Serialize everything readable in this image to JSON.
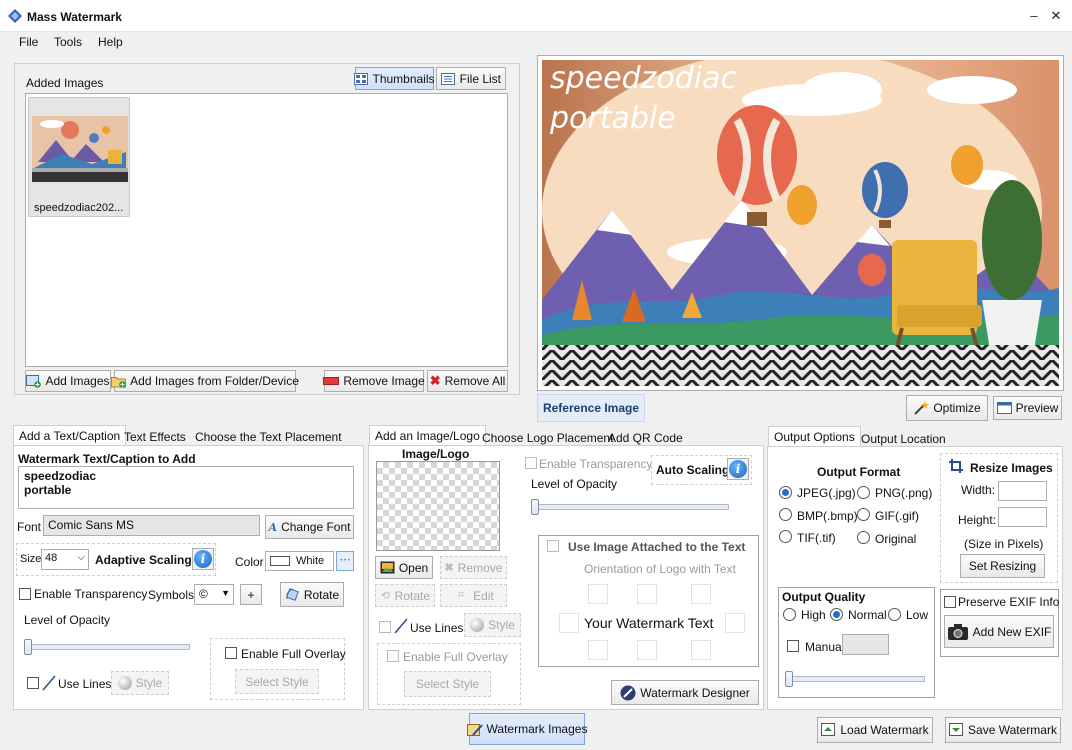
{
  "window": {
    "title": "Mass Watermark",
    "minimize": "–",
    "close": "✕"
  },
  "menu": [
    "File",
    "Tools",
    "Help"
  ],
  "added_images": {
    "label": "Added Images",
    "view_thumbnails": "Thumbnails",
    "view_file_list": "File List",
    "items": [
      {
        "name": "speedzodiac202..."
      }
    ],
    "add_images": "Add Images",
    "add_from_folder": "Add Images from Folder/Device",
    "remove_image": "Remove Image",
    "remove_all": "Remove All"
  },
  "reference": {
    "overlay_line1": "speedzodiac",
    "overlay_line2": "portable",
    "label": "Reference Image",
    "optimize": "Optimize",
    "preview": "Preview"
  },
  "text_panel": {
    "tabs": [
      "Add a Text/Caption",
      "Text Effects",
      "Choose the Text Placement"
    ],
    "caption_label": "Watermark Text/Caption to Add",
    "caption_line1": "speedzodiac",
    "caption_line2": "portable",
    "font_label": "Font",
    "font_value": "Comic Sans MS",
    "change_font": "Change Font",
    "size_label": "Size",
    "size_value": "48",
    "adaptive_scaling": "Adaptive Scaling",
    "color_label": "Color",
    "color_value": "White",
    "enable_transparency": "Enable Transparency",
    "symbols_label": "Symbols",
    "symbol_value": "©",
    "plus": "+",
    "rotate": "Rotate",
    "opacity_label": "Level of Opacity",
    "enable_full_overlay": "Enable Full Overlay",
    "select_style": "Select Style",
    "use_lines": "Use Lines",
    "style": "Style"
  },
  "logo_panel": {
    "tabs": [
      "Add an Image/Logo",
      "Choose Logo Placement",
      "Add QR Code"
    ],
    "image_logo_label": "Image/Logo",
    "enable_transparency": "Enable Transparency",
    "auto_scaling": "Auto Scaling",
    "opacity_label": "Level of Opacity",
    "use_image_attached": "Use Image Attached to the Text",
    "orientation_label": "Orientation of Logo with Text",
    "your_watermark_text": "Your Watermark Text",
    "open": "Open",
    "remove": "Remove",
    "rotate": "Rotate",
    "edit": "Edit",
    "use_lines": "Use Lines",
    "style": "Style",
    "enable_full_overlay": "Enable Full Overlay",
    "select_style": "Select Style",
    "watermark_designer": "Watermark Designer"
  },
  "output_panel": {
    "tabs": [
      "Output Options",
      "Output Location"
    ],
    "format_label": "Output Format",
    "formats": [
      "JPEG(.jpg)",
      "PNG(.png)",
      "BMP(.bmp)",
      "GIF(.gif)",
      "TIF(.tif)",
      "Original"
    ],
    "selected_format": "JPEG(.jpg)",
    "resize_label": "Resize Images",
    "width_label": "Width:",
    "height_label": "Height:",
    "size_note": "(Size in Pixels)",
    "set_resizing": "Set Resizing",
    "quality_label": "Output Quality",
    "quality_options": [
      "High",
      "Normal",
      "Low"
    ],
    "selected_quality": "Normal",
    "manual": "Manual",
    "preserve_exif": "Preserve EXIF Info",
    "add_new_exif": "Add New EXIF"
  },
  "footer": {
    "watermark_images": "Watermark Images",
    "load_watermark": "Load Watermark",
    "save_watermark": "Save Watermark"
  }
}
